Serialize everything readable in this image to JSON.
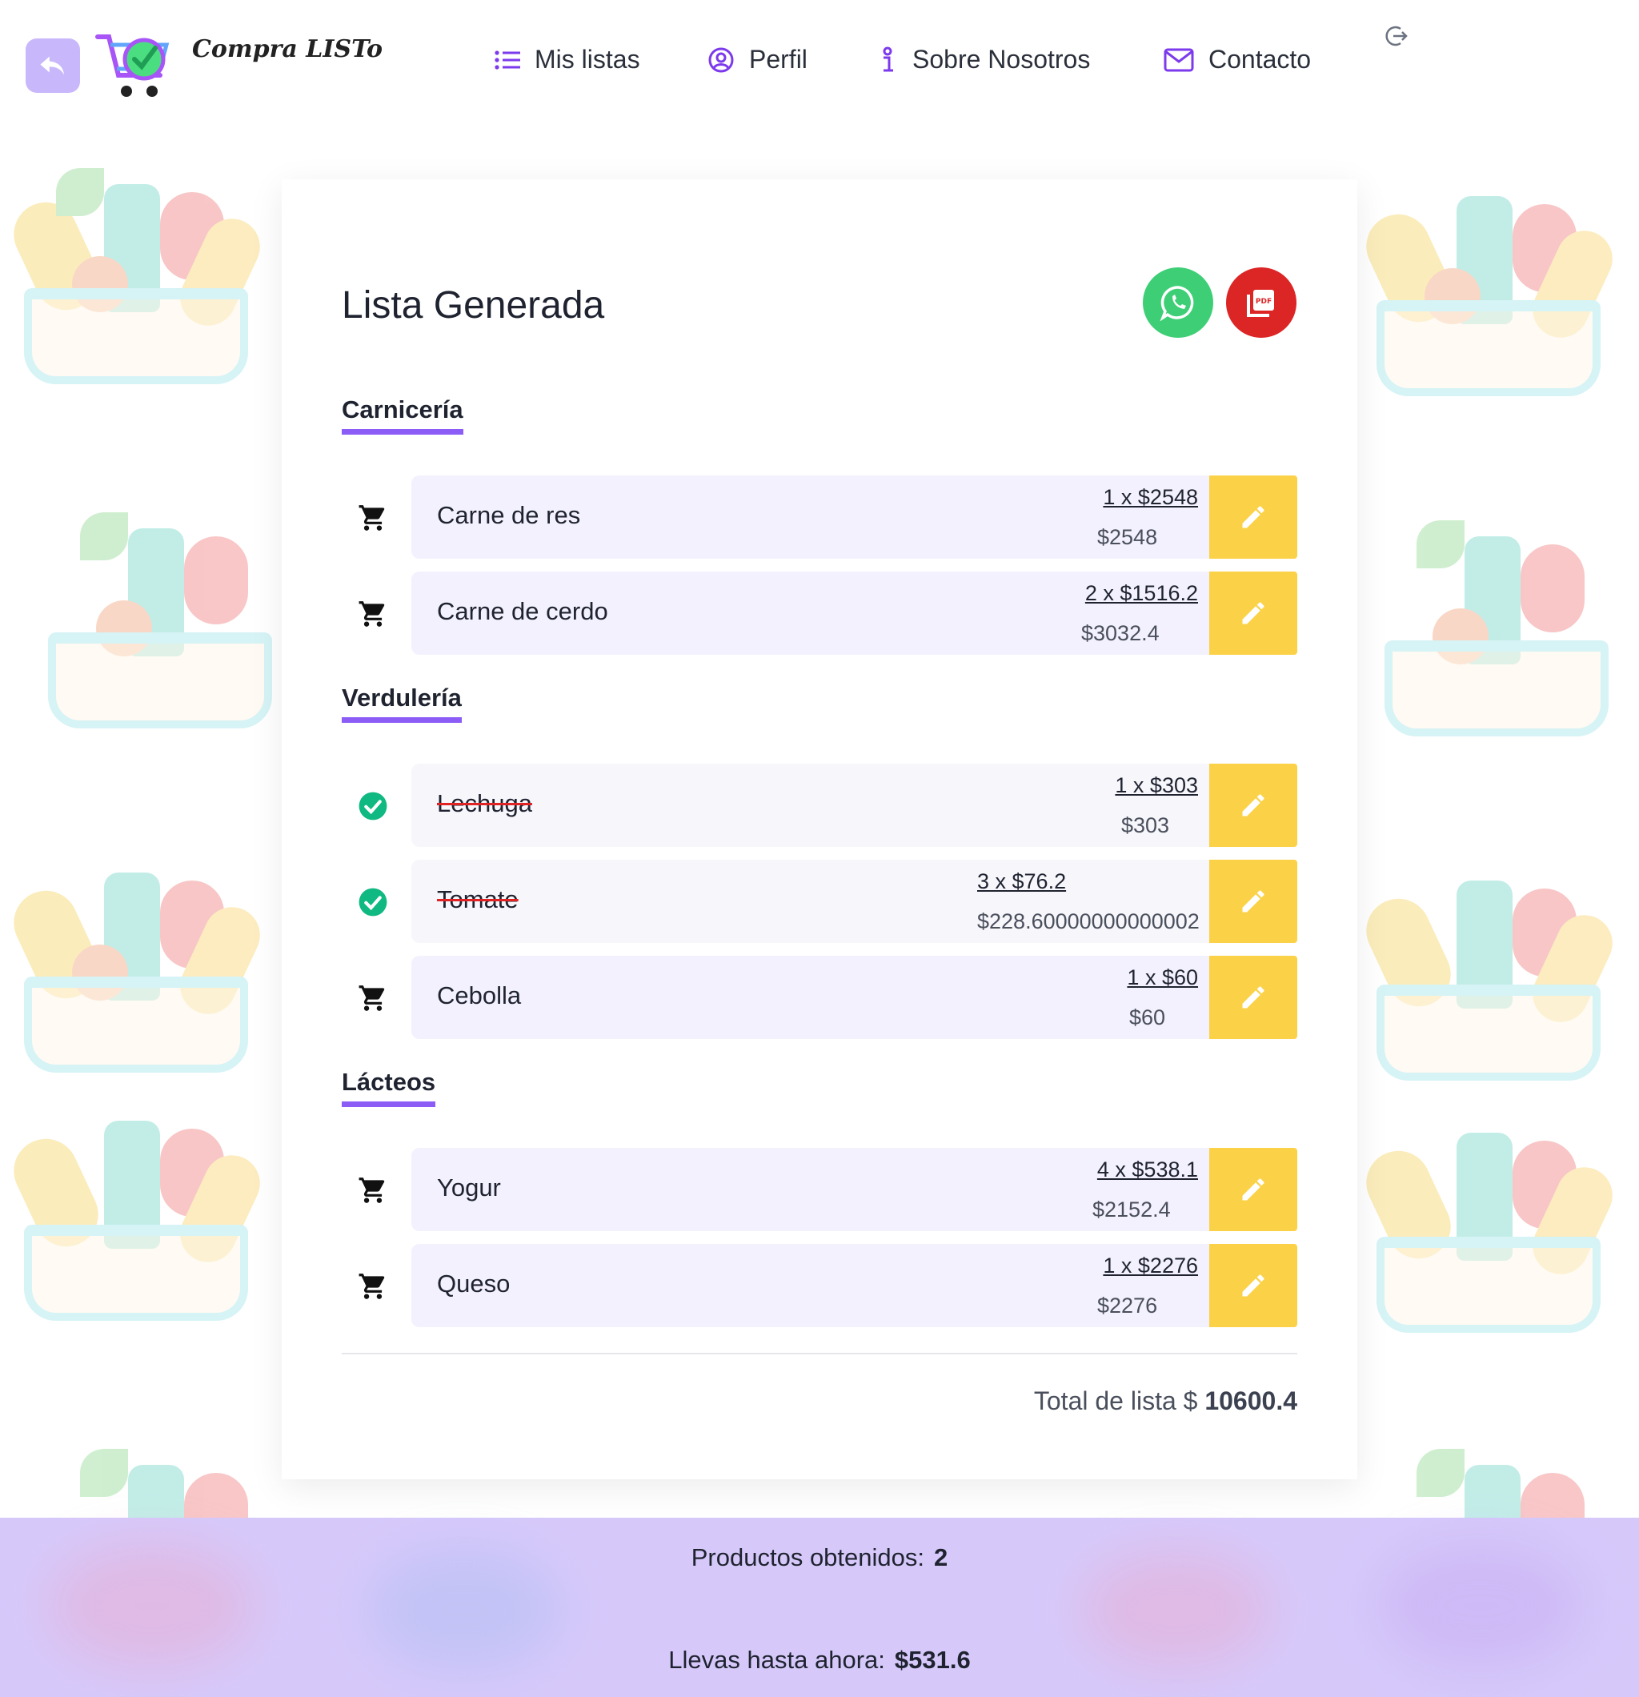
{
  "app": {
    "logo_text": "Compra LISTo"
  },
  "nav": {
    "items": [
      {
        "label": "Mis listas",
        "icon": "list-icon"
      },
      {
        "label": "Perfil",
        "icon": "user-circle-icon"
      },
      {
        "label": "Sobre Nosotros",
        "icon": "info-icon"
      },
      {
        "label": "Contacto",
        "icon": "envelope-icon"
      }
    ],
    "logout_icon": "logout-icon"
  },
  "card": {
    "title": "Lista Generada",
    "share": {
      "whatsapp_icon": "whatsapp-icon",
      "pdf_icon": "pdf-icon"
    },
    "categories": [
      {
        "name": "Carnicería"
      },
      {
        "name": "Verdulería"
      },
      {
        "name": "Lácteos"
      }
    ],
    "items": [
      {
        "name": "Carne de res",
        "qty_price": "1 x $2548",
        "subtotal": "$2548",
        "status": "pending"
      },
      {
        "name": "Carne de cerdo",
        "qty_price": "2 x $1516.2",
        "subtotal": "$3032.4",
        "status": "pending"
      },
      {
        "name": "Lechuga",
        "qty_price": "1 x $303",
        "subtotal": "$303",
        "status": "done"
      },
      {
        "name": "Tomate",
        "qty_price": "3 x $76.2",
        "subtotal": "$228.60000000000002",
        "status": "done"
      },
      {
        "name": "Cebolla",
        "qty_price": "1 x $60",
        "subtotal": "$60",
        "status": "pending"
      },
      {
        "name": "Yogur",
        "qty_price": "4 x $538.1",
        "subtotal": "$2152.4",
        "status": "pending"
      },
      {
        "name": "Queso",
        "qty_price": "1 x $2276",
        "subtotal": "$2276",
        "status": "pending"
      }
    ],
    "total_label": "Total de lista $",
    "total_value": "10600.4"
  },
  "footer": {
    "obtained_label": "Productos obtenidos:",
    "obtained_value": "2",
    "so_far_label": "Llevas hasta ahora:",
    "so_far_value": "$531.6"
  },
  "colors": {
    "accent": "#8b5cf6",
    "edit_button": "#fbd247",
    "whatsapp": "#3ecf76",
    "pdf": "#dc2626",
    "done_check": "#10b981",
    "footer_bg": "#d6c9fa"
  }
}
